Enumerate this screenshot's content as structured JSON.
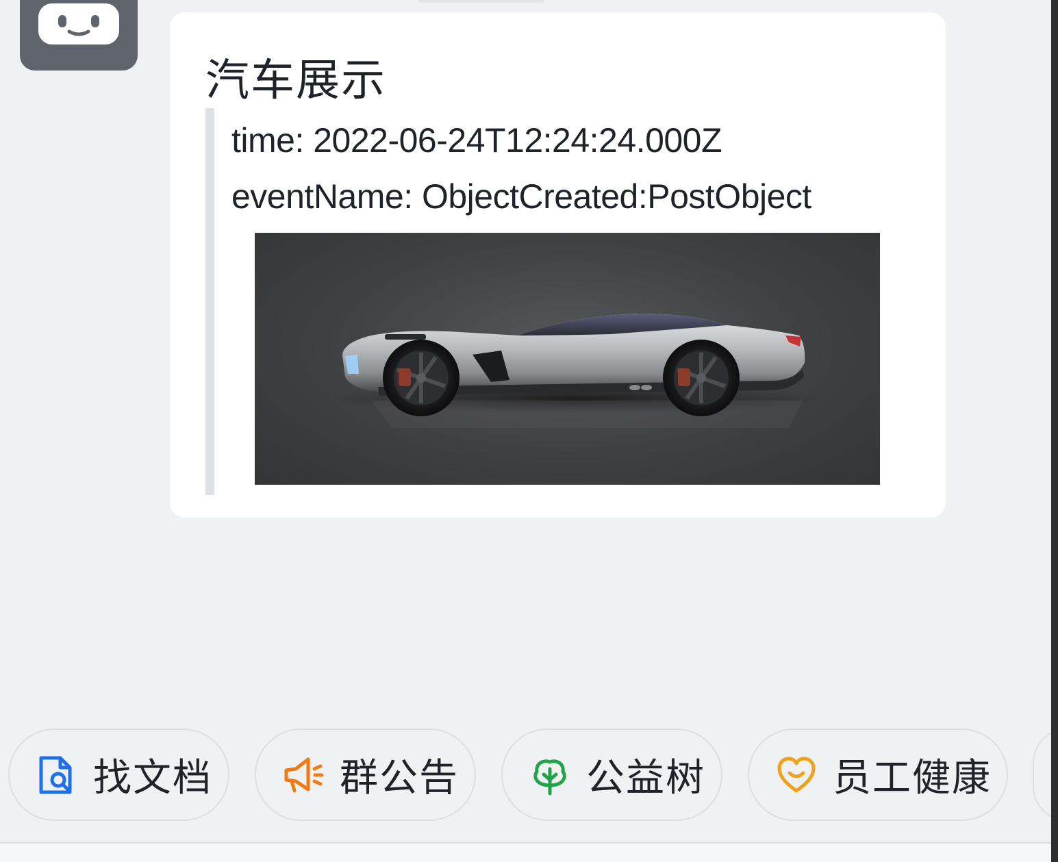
{
  "message": {
    "title": "汽车展示",
    "fields": {
      "time": "time: 2022-06-24T12:24:24.000Z",
      "event_name": "eventName: ObjectCreated:PostObject"
    }
  },
  "shortcuts": [
    {
      "label": "找文档",
      "icon": "doc-search-icon",
      "color": "#1e6fe8"
    },
    {
      "label": "群公告",
      "icon": "megaphone-icon",
      "color": "#f07a15"
    },
    {
      "label": "公益树",
      "icon": "tree-icon",
      "color": "#21a34a"
    },
    {
      "label": "员工健康",
      "icon": "heart-smile-icon",
      "color": "#f0a11a"
    }
  ],
  "colors": {
    "background": "#f0f1f3",
    "card": "#ffffff",
    "avatar": "#5f636b"
  }
}
